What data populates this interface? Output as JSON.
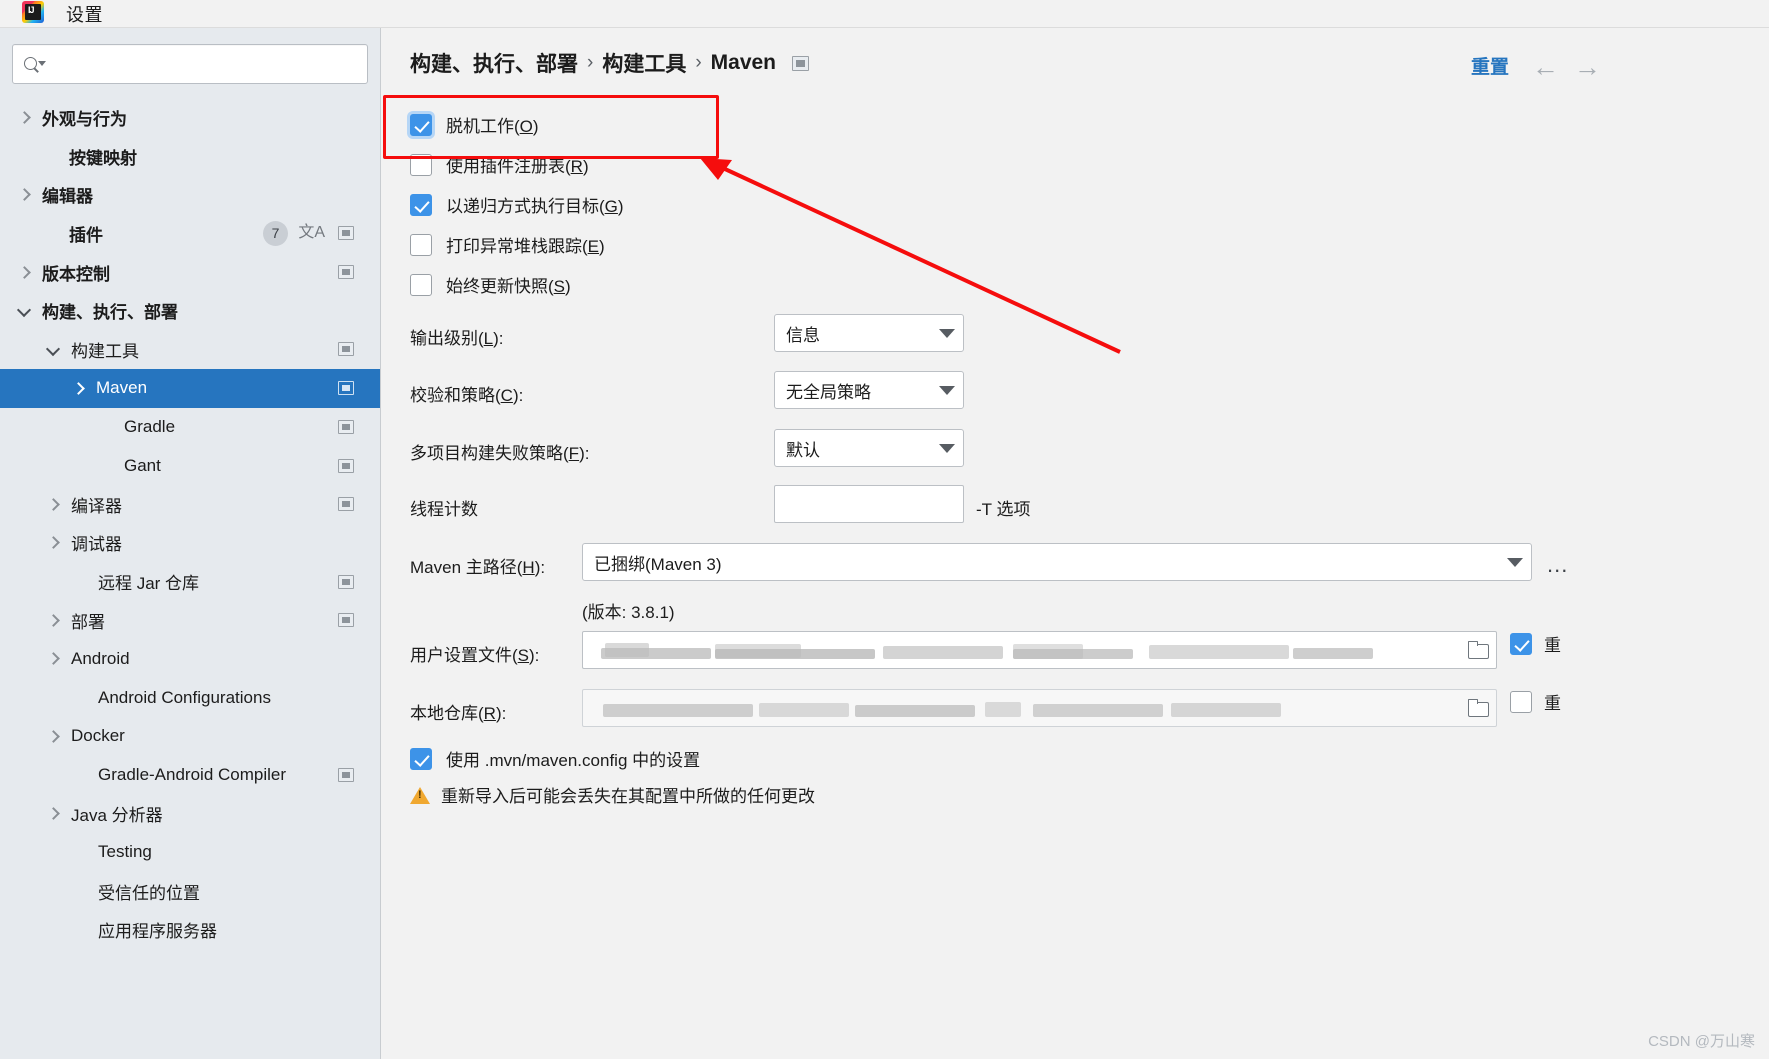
{
  "window": {
    "title": "设置",
    "app_icon": "intellij-idea-icon"
  },
  "sidebar": {
    "search": {
      "value": "",
      "placeholder": "",
      "icon": "search-icon"
    },
    "items": [
      {
        "label": "外观与行为",
        "arrow": "right",
        "indent": 18,
        "bold": true,
        "selected": false,
        "badge": null,
        "lang": false,
        "chip": false
      },
      {
        "label": "按键映射",
        "arrow": "none",
        "indent": 45,
        "bold": true,
        "selected": false,
        "badge": null,
        "lang": false,
        "chip": false
      },
      {
        "label": "编辑器",
        "arrow": "right",
        "indent": 18,
        "bold": true,
        "selected": false,
        "badge": null,
        "lang": false,
        "chip": false
      },
      {
        "label": "插件",
        "arrow": "none",
        "indent": 45,
        "bold": true,
        "selected": false,
        "badge": "7",
        "lang": true,
        "chip": true
      },
      {
        "label": "版本控制",
        "arrow": "right",
        "indent": 18,
        "bold": true,
        "selected": false,
        "badge": null,
        "lang": false,
        "chip": true
      },
      {
        "label": "构建、执行、部署",
        "arrow": "down",
        "indent": 18,
        "bold": true,
        "selected": false,
        "badge": null,
        "lang": false,
        "chip": false
      },
      {
        "label": "构建工具",
        "arrow": "down",
        "indent": 47,
        "bold": false,
        "selected": false,
        "badge": null,
        "lang": false,
        "chip": true
      },
      {
        "label": "Maven",
        "arrow": "right",
        "indent": 72,
        "bold": false,
        "selected": true,
        "badge": null,
        "lang": false,
        "chip": true
      },
      {
        "label": "Gradle",
        "arrow": "none",
        "indent": 100,
        "bold": false,
        "selected": false,
        "badge": null,
        "lang": false,
        "chip": true
      },
      {
        "label": "Gant",
        "arrow": "none",
        "indent": 100,
        "bold": false,
        "selected": false,
        "badge": null,
        "lang": false,
        "chip": true
      },
      {
        "label": "编译器",
        "arrow": "right",
        "indent": 47,
        "bold": false,
        "selected": false,
        "badge": null,
        "lang": false,
        "chip": true
      },
      {
        "label": "调试器",
        "arrow": "right",
        "indent": 47,
        "bold": false,
        "selected": false,
        "badge": null,
        "lang": false,
        "chip": false
      },
      {
        "label": "远程 Jar 仓库",
        "arrow": "none",
        "indent": 74,
        "bold": false,
        "selected": false,
        "badge": null,
        "lang": false,
        "chip": true
      },
      {
        "label": "部署",
        "arrow": "right",
        "indent": 47,
        "bold": false,
        "selected": false,
        "badge": null,
        "lang": false,
        "chip": true
      },
      {
        "label": "Android",
        "arrow": "right",
        "indent": 47,
        "bold": false,
        "selected": false,
        "badge": null,
        "lang": false,
        "chip": false
      },
      {
        "label": "Android Configurations",
        "arrow": "none",
        "indent": 74,
        "bold": false,
        "selected": false,
        "badge": null,
        "lang": false,
        "chip": false
      },
      {
        "label": "Docker",
        "arrow": "right",
        "indent": 47,
        "bold": false,
        "selected": false,
        "badge": null,
        "lang": false,
        "chip": false
      },
      {
        "label": "Gradle-Android Compiler",
        "arrow": "none",
        "indent": 74,
        "bold": false,
        "selected": false,
        "badge": null,
        "lang": false,
        "chip": true
      },
      {
        "label": "Java 分析器",
        "arrow": "right",
        "indent": 47,
        "bold": false,
        "selected": false,
        "badge": null,
        "lang": false,
        "chip": false
      },
      {
        "label": "Testing",
        "arrow": "none",
        "indent": 74,
        "bold": false,
        "selected": false,
        "badge": null,
        "lang": false,
        "chip": false
      },
      {
        "label": "受信任的位置",
        "arrow": "none",
        "indent": 74,
        "bold": false,
        "selected": false,
        "badge": null,
        "lang": false,
        "chip": false
      },
      {
        "label": "应用程序服务器",
        "arrow": "none",
        "indent": 74,
        "bold": false,
        "selected": false,
        "badge": null,
        "lang": false,
        "chip": false
      }
    ]
  },
  "header": {
    "breadcrumb": [
      "构建、执行、部署",
      "构建工具",
      "Maven"
    ],
    "separator": "›",
    "reset_label": "重置",
    "back_icon": "arrow-left-icon",
    "forward_icon": "arrow-right-icon"
  },
  "main": {
    "checkboxes": [
      {
        "label_prefix": "脱机工作(",
        "mnemonic": "O",
        "label_suffix": ")",
        "checked": true,
        "focused": true
      },
      {
        "label_prefix": "使用插件注册表(",
        "mnemonic": "R",
        "label_suffix": ")",
        "checked": false,
        "focused": false
      },
      {
        "label_prefix": "以递归方式执行目标(",
        "mnemonic": "G",
        "label_suffix": ")",
        "checked": true,
        "focused": false
      },
      {
        "label_prefix": "打印异常堆栈跟踪(",
        "mnemonic": "E",
        "label_suffix": ")",
        "checked": false,
        "focused": false
      },
      {
        "label_prefix": "始终更新快照(",
        "mnemonic": "S",
        "label_suffix": ")",
        "checked": false,
        "focused": false
      }
    ],
    "combos": [
      {
        "label_prefix": "输出级别(",
        "mnemonic": "L",
        "label_suffix": "):",
        "value": "信息"
      },
      {
        "label_prefix": "校验和策略(",
        "mnemonic": "C",
        "label_suffix": "):",
        "value": "无全局策略"
      },
      {
        "label_prefix": "多项目构建失败策略(",
        "mnemonic": "F",
        "label_suffix": "):",
        "value": "默认"
      }
    ],
    "thread_count": {
      "label": "线程计数",
      "value": "",
      "hint": "-T 选项"
    },
    "maven_home": {
      "label_prefix": "Maven 主路径(",
      "mnemonic": "H",
      "label_suffix": "):",
      "value": "已捆绑(Maven 3)",
      "version_note": "(版本: 3.8.1)",
      "more_button": "..."
    },
    "user_settings": {
      "label_prefix": "用户设置文件(",
      "mnemonic": "S",
      "label_suffix": "):",
      "value": "",
      "override_label": "重",
      "override_checked": true
    },
    "local_repo": {
      "label_prefix": "本地仓库(",
      "mnemonic": "R",
      "label_suffix": "):",
      "value": "",
      "override_label": "重",
      "override_checked": false
    },
    "mvn_config": {
      "label": "使用 .mvn/maven.config 中的设置",
      "checked": true
    },
    "warning": {
      "icon": "warning-triangle-icon",
      "text": "重新导入后可能会丢失在其配置中所做的任何更改"
    }
  },
  "annotation": {
    "box_color": "#f50d0d",
    "arrow_color": "#f50d0d"
  },
  "watermark": "CSDN @万山寒"
}
